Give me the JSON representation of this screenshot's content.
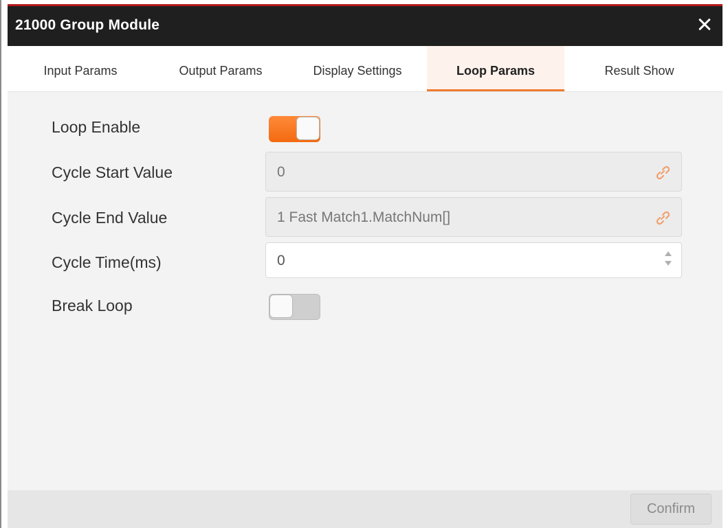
{
  "window": {
    "title": "21000 Group Module",
    "accent_color": "#b31a1a"
  },
  "tabs": [
    {
      "label": "Input Params",
      "active": false
    },
    {
      "label": "Output Params",
      "active": false
    },
    {
      "label": "Display Settings",
      "active": false
    },
    {
      "label": "Loop Params",
      "active": true
    },
    {
      "label": "Result Show",
      "active": false
    }
  ],
  "form": {
    "loop_enable": {
      "label": "Loop Enable",
      "state": "on"
    },
    "cycle_start": {
      "label": "Cycle Start Value",
      "value": "0",
      "icon": "link-icon"
    },
    "cycle_end": {
      "label": "Cycle End Value",
      "value": "1 Fast Match1.MatchNum[]",
      "icon": "link-icon"
    },
    "cycle_time": {
      "label": "Cycle Time(ms)",
      "value": "0"
    },
    "break_loop": {
      "label": "Break Loop",
      "state": "off"
    }
  },
  "footer": {
    "confirm_label": "Confirm"
  },
  "colors": {
    "toggle_on": "#f36a10",
    "active_tab_underline": "#f07b2e",
    "titlebar": "#1f1f1f"
  }
}
